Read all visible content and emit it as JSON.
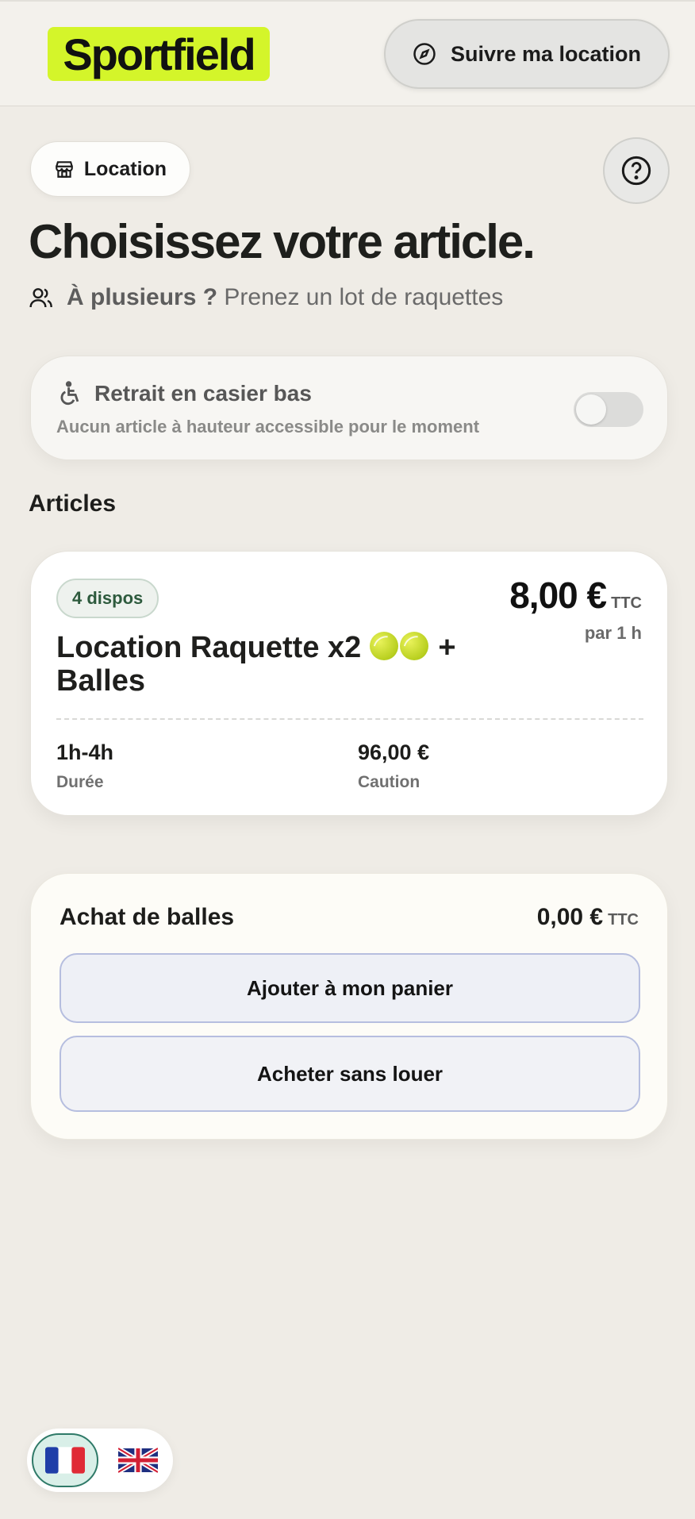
{
  "header": {
    "logo_text": "Sportfield",
    "track_label": "Suivre ma location",
    "track_icon": "compass-icon"
  },
  "page": {
    "category_label": "Location",
    "category_icon": "store-icon",
    "help_icon": "help-circle-icon",
    "title": "Choisissez votre article.",
    "lots_bold": "À plusieurs ?",
    "lots_text": "Prenez un lot de raquettes",
    "lots_icon": "users-icon"
  },
  "accessibility": {
    "title": "Retrait en casier bas",
    "subtitle": "Aucun article à hauteur accessible pour le moment",
    "icon": "wheelchair-icon",
    "toggle_on": false
  },
  "articles": {
    "section_label": "Articles",
    "items": [
      {
        "badge": "4 dispos",
        "name_prefix": "Location Raquette x2",
        "name_suffix": "+ Balles",
        "price": "8,00 €",
        "price_suffix": "TTC",
        "per": "par 1 h",
        "duration_value": "1h-4h",
        "duration_label": "Durée",
        "deposit_value": "96,00 €",
        "deposit_label": "Caution"
      }
    ]
  },
  "balls": {
    "title": "Achat de balles",
    "price": "0,00 €",
    "price_suffix": "TTC",
    "add_label": "Ajouter à mon panier",
    "buy_label": "Acheter sans louer"
  },
  "language": {
    "options": [
      {
        "code": "fr",
        "icon": "flag-fr-icon",
        "selected": true
      },
      {
        "code": "en",
        "icon": "flag-uk-icon",
        "selected": false
      }
    ]
  }
}
